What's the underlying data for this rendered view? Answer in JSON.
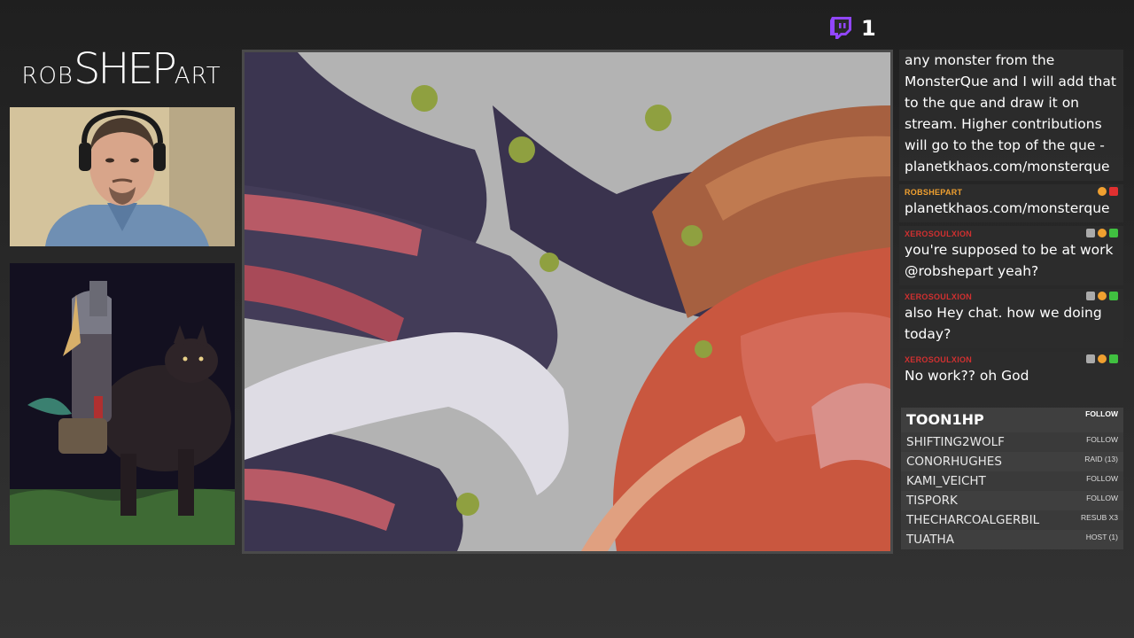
{
  "logo": {
    "part1": "ROB",
    "part2": "SHEP",
    "part3": "ART"
  },
  "twitch": {
    "icon": "twitch-icon",
    "viewer_count": "1"
  },
  "chat": {
    "messages": [
      {
        "user": "",
        "text": "any monster from the MonsterQue and I will add that to the que and draw it on stream. Higher contributions will go to the top of the que - planetkhaos.com/monsterque"
      },
      {
        "user": "ROBSHEPART",
        "user_color": "#f0a030",
        "text": "planetkhaos.com/monsterque"
      },
      {
        "user": "XEROSOULXION",
        "user_color": "#d03030",
        "text": "you're supposed to be at work @robshepart yeah?"
      },
      {
        "user": "XEROSOULXION",
        "user_color": "#d03030",
        "text": "also Hey chat. how we doing today?"
      },
      {
        "user": "XEROSOULXION",
        "user_color": "#d03030",
        "text": "No work?? oh God"
      }
    ]
  },
  "events": [
    {
      "name": "TOON1HP",
      "type": "FOLLOW"
    },
    {
      "name": "SHIFTING2WOLF",
      "type": "FOLLOW"
    },
    {
      "name": "CONORHUGHES",
      "type": "RAID (13)"
    },
    {
      "name": "KAMI_VEICHT",
      "type": "FOLLOW"
    },
    {
      "name": "TISPORK",
      "type": "FOLLOW"
    },
    {
      "name": "THECHARCOALGERBIL",
      "type": "RESUB X3"
    },
    {
      "name": "TUATHA",
      "type": "HOST (1)"
    }
  ],
  "colors": {
    "twitch_purple": "#9146ff",
    "canvas_red": "#c9573f",
    "canvas_purple": "#3b3550"
  }
}
